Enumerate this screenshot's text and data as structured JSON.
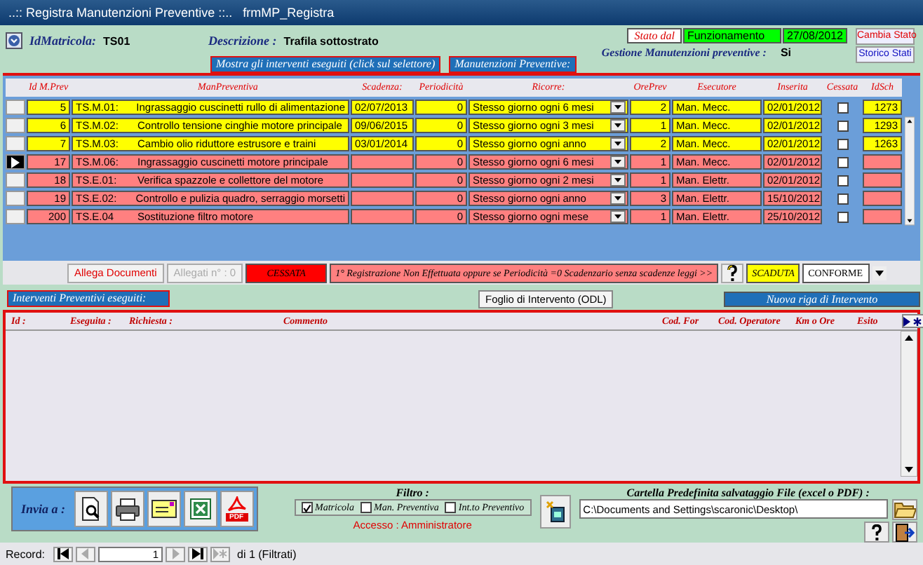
{
  "window": {
    "title": "..:: Registra Manutenzioni Preventive ::..   frmMP_Registra"
  },
  "header": {
    "id_label": "IdMatricola:",
    "id_value": "TS01",
    "desc_label": "Descrizione :",
    "desc_value": "Trafila sottostrato",
    "state_label": "Stato dal",
    "state_value": "Funzionamento",
    "state_date": "27/08/2012",
    "gestione_label": "Gestione Manutenzioni preventive  :",
    "gestione_value": "Si"
  },
  "state_buttons": [
    "Cambia Stato",
    "Storico Stati"
  ],
  "captions": [
    "Mostra gli interventi eseguiti (click sul selettore)",
    "Manutenzioni Preventive:"
  ],
  "grid": {
    "columns": [
      "Id M.Prev",
      "ManPreventiva",
      "Scadenza:",
      "Periodicità",
      "Ricorre:",
      "OrePrev",
      "Esecutore",
      "Inserita",
      "Cessata",
      "IdSch"
    ],
    "rows": [
      {
        "id": "5",
        "code": "TS.M.01:",
        "description": "Ingrassaggio cuscinetti rullo di alimentazione",
        "scadenza": "02/07/2013",
        "periodicita": "0",
        "ricorre": "Stesso giorno  ogni 6 mesi",
        "ore_prev": "2",
        "esecutore": "Man. Mecc.",
        "inserita": "02/01/2012",
        "cessata": false,
        "id_sch": "1273",
        "color": "#ffff00",
        "current": false
      },
      {
        "id": "6",
        "code": "TS.M.02:",
        "description": "Controllo tensione cinghie motore principale",
        "scadenza": "09/06/2015",
        "periodicita": "0",
        "ricorre": "Stesso giorno  ogni 3 mesi",
        "ore_prev": "1",
        "esecutore": "Man. Mecc.",
        "inserita": "02/01/2012",
        "cessata": false,
        "id_sch": "1293",
        "color": "#ffff00",
        "current": false
      },
      {
        "id": "7",
        "code": "TS.M.03:",
        "description": "Cambio olio riduttore estrusore e traini",
        "scadenza": "03/01/2014",
        "periodicita": "0",
        "ricorre": "Stesso giorno  ogni anno",
        "ore_prev": "2",
        "esecutore": "Man. Mecc.",
        "inserita": "02/01/2012",
        "cessata": false,
        "id_sch": "1263",
        "color": "#ffff00",
        "current": false
      },
      {
        "id": "17",
        "code": "TS.M.06:",
        "description": "Ingrassaggio cuscinetti motore principale",
        "periodicita": "0",
        "ricorre": "Stesso giorno  ogni 6 mesi",
        "ore_prev": "1",
        "esecutore": "Man. Mecc.",
        "inserita": "02/01/2012",
        "cessata": false,
        "color": "#ff8080",
        "current": true
      },
      {
        "id": "18",
        "code": "TS.E.01:",
        "description": "Verifica spazzole e collettore del motore",
        "periodicita": "0",
        "ricorre": "Stesso giorno  ogni 2 mesi",
        "ore_prev": "1",
        "esecutore": "Man. Elettr.",
        "inserita": "02/01/2012",
        "cessata": false,
        "color": "#ff8080",
        "current": false
      },
      {
        "id": "19",
        "code": "TS.E.02:",
        "description": "Controllo e pulizia quadro, serraggio morsetti",
        "periodicita": "0",
        "ricorre": "Stesso giorno  ogni anno",
        "ore_prev": "3",
        "esecutore": "Man. Elettr.",
        "inserita": "15/10/2012",
        "cessata": false,
        "color": "#ff8080",
        "current": false
      },
      {
        "id": "200",
        "code": "TS.E.04",
        "description": "Sostituzione filtro motore",
        "periodicita": "0",
        "ricorre": "Stesso giorno  ogni  mese",
        "ore_prev": "1",
        "esecutore": "Man. Elettr.",
        "inserita": "25/10/2012",
        "cessata": false,
        "color": "#ff8080",
        "current": false
      }
    ]
  },
  "toolbar": {
    "attach_button": "Allega Documenti",
    "attach_count": "Allegati n° : 0",
    "legend": [
      {
        "label": "CESSATA",
        "color": "#ff0000"
      },
      {
        "label": "1° Registrazione Non Effettuata  oppure  se Periodicità =0  Scadenzario senza scadenze leggi >>",
        "color": "#ff8080"
      },
      {
        "label": "SCADUTA",
        "color": "#ffff00"
      },
      {
        "label": "CONFORME",
        "color": "#ffffff"
      }
    ]
  },
  "interventi": {
    "caption": "Interventi Preventivi eseguiti:",
    "odl_button": "Foglio di Intervento (ODL)",
    "new_row_button": "Nuova riga di Intervento",
    "columns": [
      "Id :",
      "Eseguita :",
      "Richiesta :",
      "Commento",
      "Cod. For",
      "Cod. Operatore",
      "Km o Ore",
      "Esito"
    ]
  },
  "send": {
    "label": "Invia a :",
    "pdf_label": "PDF"
  },
  "filter": {
    "title": "Filtro :",
    "options": [
      {
        "label": "Matricola",
        "checked": true
      },
      {
        "label": "Man. Preventiva",
        "checked": false
      },
      {
        "label": "Int.to Preventivo",
        "checked": false
      }
    ],
    "access": "Accesso : Amministratore"
  },
  "folder": {
    "label": "Cartella Predefinita  salvataggio File (excel o PDF) :",
    "value": "C:\\Documents and Settings\\scaronic\\Desktop\\"
  },
  "record_bar": {
    "label": "Record:",
    "value": "1",
    "total": "di 1 (Filtrati)"
  }
}
